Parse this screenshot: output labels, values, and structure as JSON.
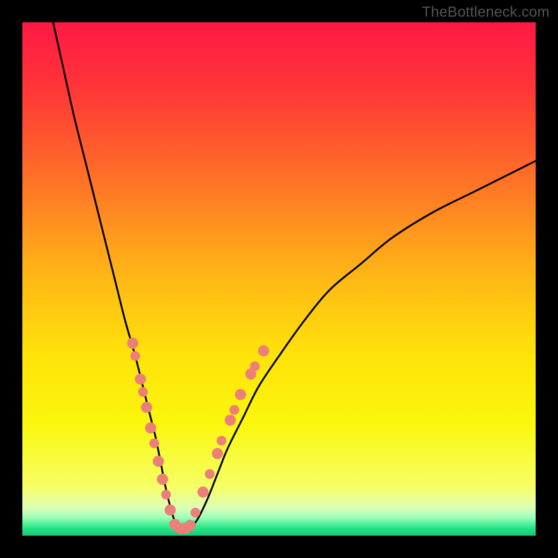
{
  "watermark": "TheBottleneck.com",
  "chart_data": {
    "type": "line",
    "title": "",
    "xlabel": "",
    "ylabel": "",
    "xlim": [
      0,
      100
    ],
    "ylim": [
      0,
      100
    ],
    "gradient_stops": [
      {
        "offset": 0.0,
        "color": "#ff1944"
      },
      {
        "offset": 0.12,
        "color": "#ff3338"
      },
      {
        "offset": 0.3,
        "color": "#ff6f28"
      },
      {
        "offset": 0.5,
        "color": "#ffb915"
      },
      {
        "offset": 0.65,
        "color": "#ffe30a"
      },
      {
        "offset": 0.78,
        "color": "#faf70c"
      },
      {
        "offset": 0.905,
        "color": "#f6ff66"
      },
      {
        "offset": 0.945,
        "color": "#dfffb6"
      },
      {
        "offset": 0.965,
        "color": "#9cffb9"
      },
      {
        "offset": 0.985,
        "color": "#25e587"
      },
      {
        "offset": 1.0,
        "color": "#17c877"
      }
    ],
    "series": [
      {
        "name": "bottleneck-curve",
        "x": [
          6,
          8,
          10,
          12,
          14,
          16,
          18,
          20,
          22,
          24,
          25,
          26,
          27,
          28,
          29,
          30,
          31,
          32,
          34,
          36,
          38,
          40,
          43,
          46,
          50,
          55,
          60,
          66,
          72,
          80,
          88,
          96,
          100
        ],
        "y": [
          100,
          91,
          82,
          74,
          66,
          58,
          50,
          42,
          35,
          27,
          23,
          19,
          14,
          9,
          5,
          2,
          1,
          1,
          3,
          7,
          12,
          17,
          23,
          29,
          35,
          42,
          48,
          53,
          58,
          63,
          67,
          71,
          73
        ]
      }
    ],
    "marker_clusters": [
      {
        "name": "left-cluster",
        "color": "#ec8079",
        "points": [
          {
            "x": 21.5,
            "y": 37.5,
            "r": 8
          },
          {
            "x": 22.0,
            "y": 35.0,
            "r": 7
          },
          {
            "x": 23.0,
            "y": 30.5,
            "r": 8
          },
          {
            "x": 23.5,
            "y": 28.0,
            "r": 7
          },
          {
            "x": 24.2,
            "y": 25.0,
            "r": 8
          },
          {
            "x": 25.0,
            "y": 21.0,
            "r": 8
          },
          {
            "x": 25.7,
            "y": 18.0,
            "r": 7
          },
          {
            "x": 26.5,
            "y": 14.5,
            "r": 8
          },
          {
            "x": 27.3,
            "y": 11.0,
            "r": 8
          },
          {
            "x": 28.0,
            "y": 8.0,
            "r": 7
          },
          {
            "x": 28.8,
            "y": 5.0,
            "r": 8
          }
        ]
      },
      {
        "name": "trough-cluster",
        "color": "#ec8079",
        "points": [
          {
            "x": 29.7,
            "y": 2.2,
            "r": 8
          },
          {
            "x": 30.7,
            "y": 1.4,
            "r": 8
          },
          {
            "x": 31.7,
            "y": 1.4,
            "r": 8
          },
          {
            "x": 32.7,
            "y": 2.0,
            "r": 8
          }
        ]
      },
      {
        "name": "right-cluster",
        "color": "#ec8079",
        "points": [
          {
            "x": 33.7,
            "y": 4.5,
            "r": 7
          },
          {
            "x": 35.2,
            "y": 8.5,
            "r": 8
          },
          {
            "x": 36.5,
            "y": 12.0,
            "r": 7
          },
          {
            "x": 38.0,
            "y": 16.0,
            "r": 8
          },
          {
            "x": 38.8,
            "y": 18.5,
            "r": 7
          },
          {
            "x": 40.5,
            "y": 22.5,
            "r": 8
          },
          {
            "x": 41.3,
            "y": 24.5,
            "r": 7
          },
          {
            "x": 42.5,
            "y": 27.5,
            "r": 8
          },
          {
            "x": 44.5,
            "y": 31.5,
            "r": 8
          },
          {
            "x": 45.3,
            "y": 33.0,
            "r": 7
          },
          {
            "x": 47.0,
            "y": 36.0,
            "r": 8
          }
        ]
      }
    ]
  }
}
